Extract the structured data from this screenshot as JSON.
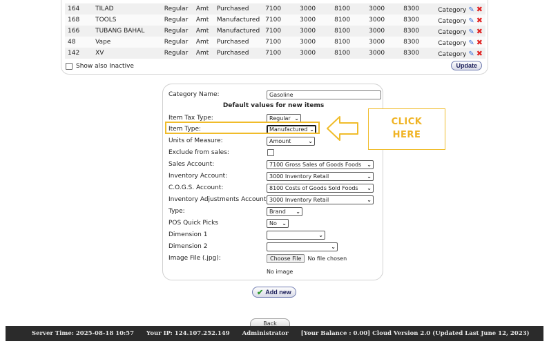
{
  "categories": {
    "rows": [
      {
        "id": "164",
        "name": "TILAD",
        "tax": "Regular",
        "uom": "Amt",
        "type": "Purchased",
        "sales": "7100",
        "inv": "3000",
        "cogs": "8100",
        "adj": "3000",
        "dim": "8300",
        "label": "Category"
      },
      {
        "id": "168",
        "name": "TOOLS",
        "tax": "Regular",
        "uom": "Amt",
        "type": "Manufactured",
        "sales": "7100",
        "inv": "3000",
        "cogs": "8100",
        "adj": "3000",
        "dim": "8300",
        "label": "Category"
      },
      {
        "id": "166",
        "name": "TUBANG BAHAL",
        "tax": "Regular",
        "uom": "Amt",
        "type": "Manufactured",
        "sales": "7100",
        "inv": "3000",
        "cogs": "8100",
        "adj": "3000",
        "dim": "8300",
        "label": "Category"
      },
      {
        "id": "48",
        "name": "Vape",
        "tax": "Regular",
        "uom": "Amt",
        "type": "Purchased",
        "sales": "7100",
        "inv": "3000",
        "cogs": "8100",
        "adj": "3000",
        "dim": "8300",
        "label": "Category"
      },
      {
        "id": "142",
        "name": "XV",
        "tax": "Regular",
        "uom": "Amt",
        "type": "Purchased",
        "sales": "7100",
        "inv": "3000",
        "cogs": "8100",
        "adj": "3000",
        "dim": "8300",
        "label": "Category"
      }
    ],
    "show_inactive_label": "Show also Inactive",
    "update_label": "Update"
  },
  "form": {
    "category_name_label": "Category Name:",
    "category_name_value": "Gasoline",
    "heading": "Default values for new items",
    "item_tax_type_label": "Item Tax Type:",
    "item_tax_type_value": "Regular",
    "item_type_label": "Item Type:",
    "item_type_value": "Manufactured",
    "uom_label": "Units of Measure:",
    "uom_value": "Amount",
    "exclude_label": "Exclude from sales:",
    "sales_account_label": "Sales Account:",
    "sales_account_value": "7100   Gross Sales of Goods Foods",
    "inventory_account_label": "Inventory Account:",
    "inventory_account_value": "3000   Inventory Retail",
    "cogs_account_label": "C.O.G.S. Account:",
    "cogs_account_value": "8100   Costs of Goods Sold Foods",
    "inv_adj_label": "Inventory Adjustments Account:",
    "inv_adj_value": "3000   Inventory Retail",
    "type_label": "Type:",
    "type_value": "Brand",
    "pos_label": "POS Quick Picks",
    "pos_value": "No",
    "dim1_label": "Dimension 1",
    "dim1_value": "",
    "dim2_label": "Dimension 2",
    "dim2_value": "",
    "image_label": "Image File (.jpg):",
    "choose_file_label": "Choose File",
    "no_file_label": "No file chosen",
    "no_image_label": "No image"
  },
  "callout": {
    "line1": "CLICK",
    "line2": "HERE"
  },
  "add_new_label": "Add new",
  "back_label": "Back",
  "footer": {
    "server_time": "Server Time: 2025-08-18 10:57",
    "ip": "Your IP: 124.107.252.149",
    "user": "Administrator",
    "balance": "[Your Balance : 0.00] Cloud Version 2.0 (Updated Last June 12, 2023)"
  },
  "colors": {
    "highlight": "#f0bc2a",
    "callout_text": "#f0b323",
    "footer_bg": "#2b2b2b"
  }
}
